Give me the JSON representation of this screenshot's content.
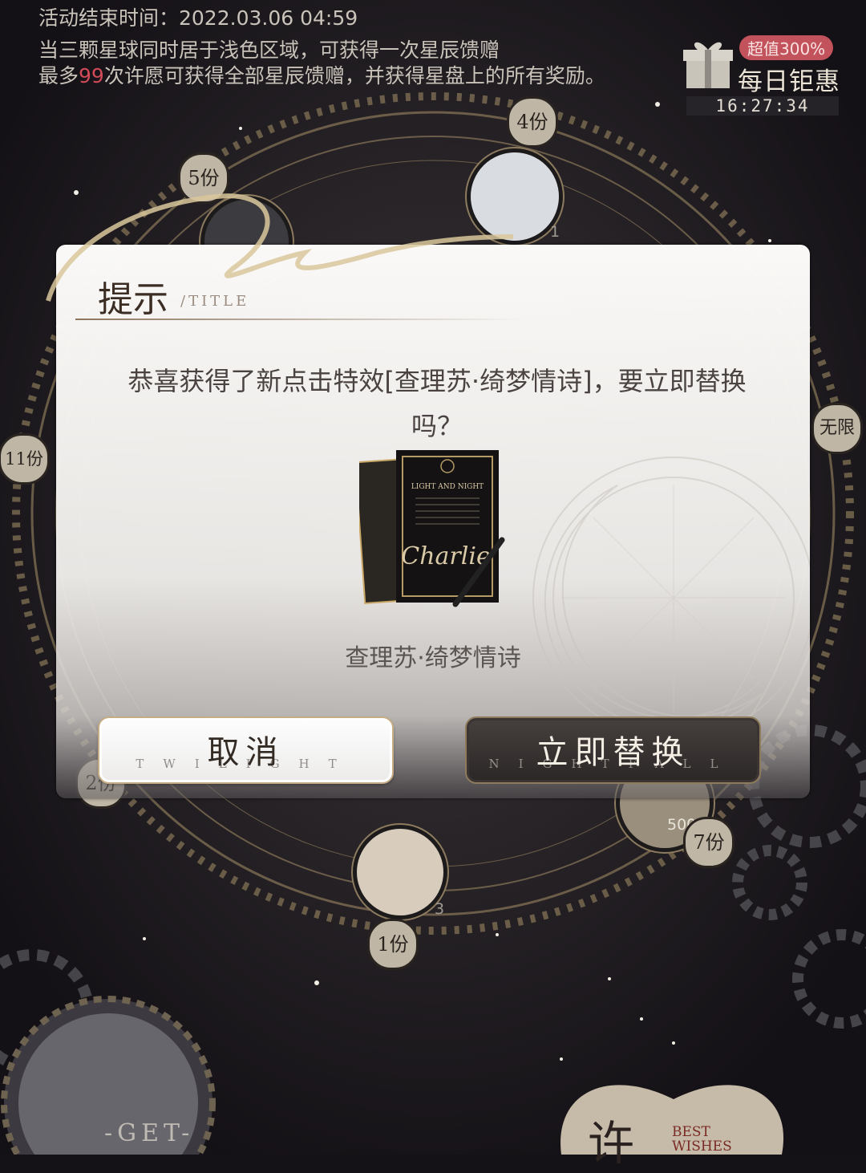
{
  "event": {
    "end_time": "活动结束时间：2022.03.06 04:59",
    "rule_line1": "当三颗星球同时居于浅色区域，可获得一次星辰馈赠",
    "rule_line2_prefix": "最多",
    "rule_line2_count": "99",
    "rule_line2_suffix": "次许愿可获得全部星辰馈赠，并获得星盘上的所有奖励。"
  },
  "daily_deal": {
    "badge": "超值300%",
    "title": "每日钜惠",
    "timer": "16:27:34",
    "icon": "gift-box-icon"
  },
  "wheel": {
    "quantities": [
      "4份",
      "5份",
      "无限",
      "11份",
      "2份",
      "7份",
      "1份"
    ],
    "item_counts": [
      "1",
      "5000",
      "3"
    ]
  },
  "dialog": {
    "title": "提示",
    "subtitle": "/TITLE",
    "message": "恭喜获得了新点击特效[查理苏·绮梦情诗]，要立即替换吗？",
    "item_name": "查理苏·绮梦情诗",
    "card_header": "LIGHT AND NIGHT",
    "card_signature": "Charlie",
    "cancel_label": "取消",
    "cancel_deco": "TWILIGHT",
    "confirm_label": "立即替换",
    "confirm_deco": "NIGHTFALL"
  },
  "bottom": {
    "get_label": "-GET-",
    "wish_char": "许",
    "best_wishes_1": "BEST",
    "best_wishes_2": "WISHES"
  },
  "colors": {
    "background": "#151217",
    "gold": "#b39a6d",
    "highlight_red": "#d04a57",
    "confirm_button": "#2f2a29"
  }
}
